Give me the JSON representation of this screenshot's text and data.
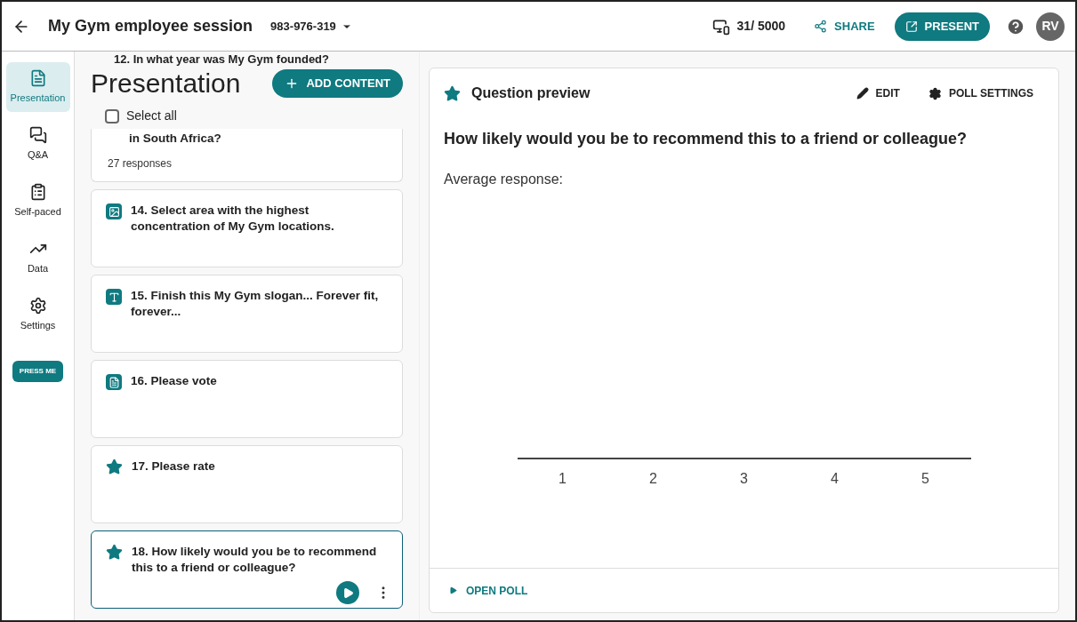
{
  "header": {
    "title": "My Gym employee session",
    "session_code": "983-976-319",
    "participants": "31/ 5000",
    "share": "SHARE",
    "present": "PRESENT",
    "avatar": "RV"
  },
  "nav": [
    {
      "label": "Presentation",
      "kind": "presentation",
      "selected": true
    },
    {
      "label": "Q&A",
      "kind": "qa",
      "selected": false
    },
    {
      "label": "Self-paced",
      "kind": "selfpaced",
      "selected": false
    },
    {
      "label": "Data",
      "kind": "data",
      "selected": false
    },
    {
      "label": "Settings",
      "kind": "settings",
      "selected": false
    }
  ],
  "press_me": "PRESS ME",
  "list": {
    "title": "Presentation",
    "add_content": "ADD CONTENT",
    "select_all": {
      "label": "Select all",
      "checked": false
    },
    "peek_item": "12. In what year was My Gym founded?",
    "items": [
      {
        "kind": "partial",
        "text": "in South Africa?",
        "responses": "27 responses",
        "selected": false
      },
      {
        "kind": "image",
        "text": "14. Select area with the highest concentration of My Gym locations.",
        "selected": false
      },
      {
        "kind": "text",
        "text": "15. Finish this My Gym slogan... Forever fit, forever...",
        "selected": false
      },
      {
        "kind": "poll",
        "text": "16. Please vote",
        "selected": false
      },
      {
        "kind": "rating",
        "text": "17. Please rate",
        "selected": false
      },
      {
        "kind": "rating",
        "text": "18. How likely would you be to recommend this to a friend or colleague?",
        "selected": true
      }
    ]
  },
  "preview": {
    "title": "Question preview",
    "edit": "EDIT",
    "poll_settings": "POLL SETTINGS",
    "question": "How likely would you be to recommend this to a friend or colleague?",
    "average_label": "Average response:",
    "scale": [
      "1",
      "2",
      "3",
      "4",
      "5"
    ],
    "open_poll": "OPEN POLL"
  }
}
